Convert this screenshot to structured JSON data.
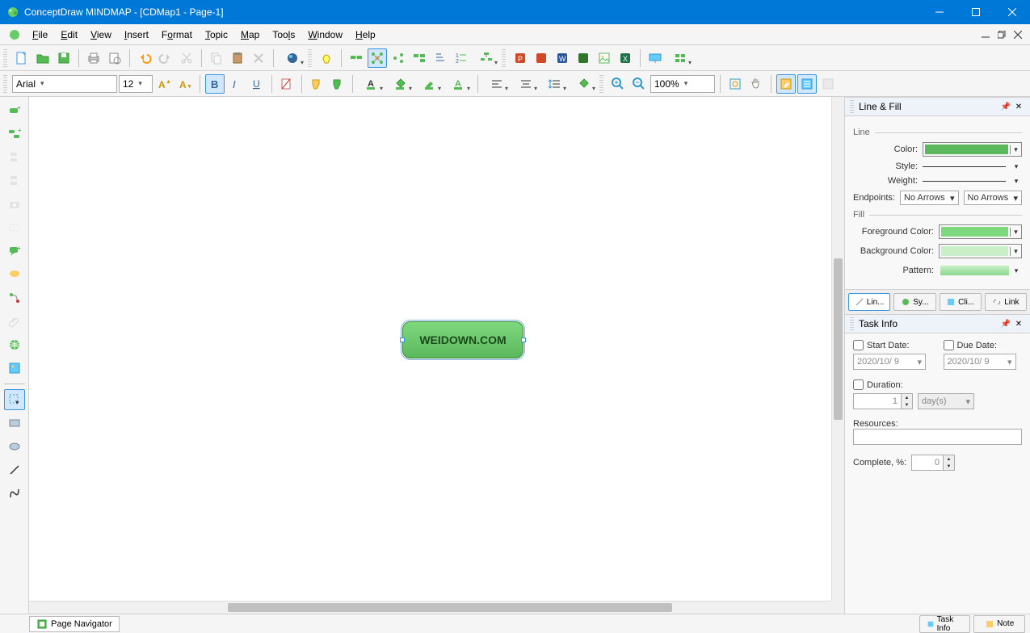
{
  "window": {
    "title": "ConceptDraw MINDMAP - [CDMap1 - Page-1]"
  },
  "menu": {
    "items": [
      "File",
      "Edit",
      "View",
      "Insert",
      "Format",
      "Topic",
      "Map",
      "Tools",
      "Window",
      "Help"
    ]
  },
  "toolbar2": {
    "font_family": "Arial",
    "font_size": "12",
    "zoom": "100%"
  },
  "canvas": {
    "main_topic_text": "WEIDOWN.COM"
  },
  "line_fill_panel": {
    "title": "Line & Fill",
    "section_line": "Line",
    "color_label": "Color:",
    "color_value": "#5cb85c",
    "style_label": "Style:",
    "weight_label": "Weight:",
    "endpoints_label": "Endpoints:",
    "endpoint_start": "No Arrows",
    "endpoint_end": "No Arrows",
    "section_fill": "Fill",
    "fg_color_label": "Foreground Color:",
    "fg_color_value": "#7ed97e",
    "bg_color_label": "Background Color:",
    "bg_color_value": "#c8efc8",
    "pattern_label": "Pattern:",
    "pattern_value": "#b8e8b8",
    "tabs": [
      "Lin...",
      "Sy...",
      "Cli...",
      "Link"
    ]
  },
  "task_info_panel": {
    "title": "Task Info",
    "start_date_label": "Start Date:",
    "start_date_value": "2020/10/ 9",
    "due_date_label": "Due Date:",
    "due_date_value": "2020/10/ 9",
    "duration_label": "Duration:",
    "duration_value": "1",
    "duration_unit": "day(s)",
    "resources_label": "Resources:",
    "complete_label": "Complete, %:",
    "complete_value": "0"
  },
  "statusbar": {
    "page_nav": "Page Navigator",
    "right_tabs": [
      "Task Info",
      "Note"
    ]
  },
  "colors": {
    "accent": "#0078d7",
    "topic_green": "#5cb85c"
  }
}
